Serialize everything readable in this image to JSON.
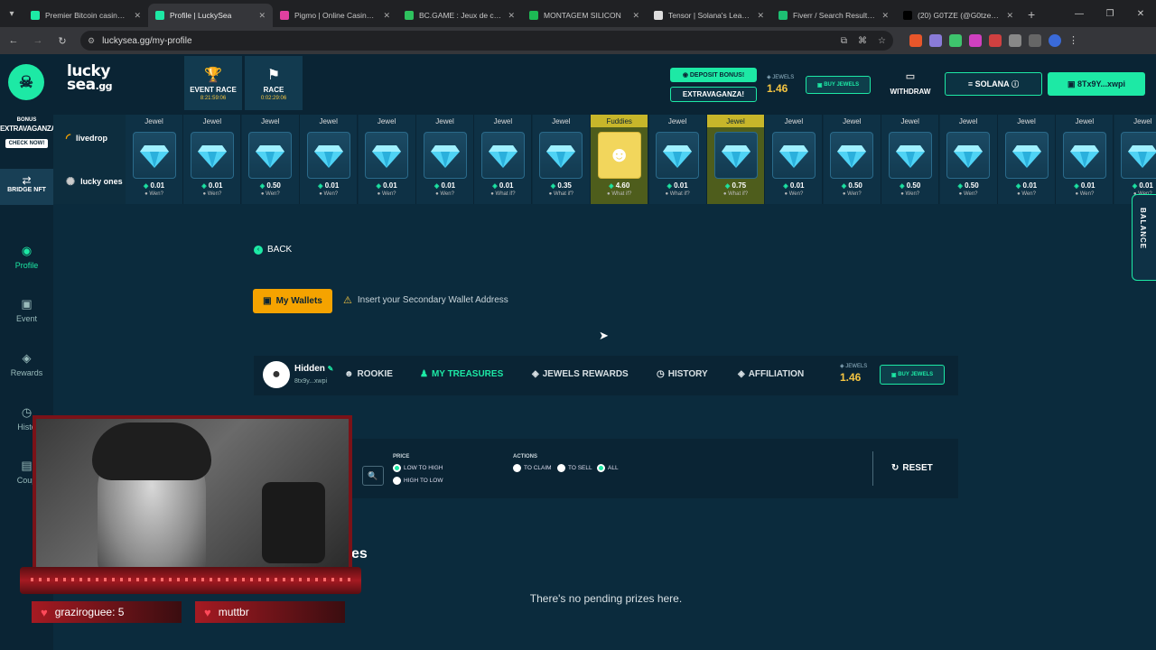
{
  "browser": {
    "tabs": [
      {
        "title": "Premier Bitcoin casino, Et",
        "color": "#1de9a5",
        "active": false
      },
      {
        "title": "Profile | LuckySea",
        "color": "#1de9a5",
        "active": true
      },
      {
        "title": "Pigmo | Online Casino | P",
        "color": "#e040a0",
        "active": false
      },
      {
        "title": "BC.GAME : Jeux de casino",
        "color": "#2ec25e",
        "active": false
      },
      {
        "title": "MONTAGEM SILICON",
        "color": "#1db954",
        "active": false
      },
      {
        "title": "Tensor | Solana's Leading",
        "color": "#dddddd",
        "active": false
      },
      {
        "title": "Fiverr / Search Results for",
        "color": "#1dbf73",
        "active": false
      },
      {
        "title": "(20) G0TZE (@G0tzeWeb",
        "color": "#000000",
        "active": false
      }
    ],
    "url": "luckysea.gg/my-profile"
  },
  "header": {
    "logo_line1": "lucky",
    "logo_line2": "sea",
    "logo_suffix": ".gg",
    "event_race": {
      "label": "EVENT RACE",
      "time": "8:21:59:06"
    },
    "race": {
      "label": "RACE",
      "time": "0:02:29:06"
    },
    "deposit_bonus": "DEPOSIT BONUS!",
    "extravaganza": "EXTRAVAGANZA!",
    "jewels_label": "JEWELS",
    "jewels_value": "1.46",
    "buy_jewels": "BUY JEWELS",
    "withdraw": "WITHDRAW",
    "network": "SOLANA",
    "wallet": "8Tx9Y...xwpi"
  },
  "sidebar": {
    "bonus_label": "BONUS",
    "bonus_title": "EXTRAVAGANZA",
    "bonus_cta": "CHECK NOW!",
    "bridge": "BRIDGE NFT",
    "items": [
      {
        "label": "Profile",
        "icon": "profile-icon",
        "active": true
      },
      {
        "label": "Event",
        "icon": "event-icon",
        "active": false
      },
      {
        "label": "Rewards",
        "icon": "rewards-icon",
        "active": false
      },
      {
        "label": "Histo",
        "icon": "history-icon",
        "active": false
      },
      {
        "label": "Coup",
        "icon": "coupon-icon",
        "active": false
      }
    ]
  },
  "livedrop": {
    "livedrop_label": "livedrop",
    "lucky_ones_label": "lucky ones",
    "items": [
      {
        "name": "Jewel",
        "value": "0.01",
        "status": "Wen?",
        "hl": false
      },
      {
        "name": "Jewel",
        "value": "0.01",
        "status": "Wen?",
        "hl": false
      },
      {
        "name": "Jewel",
        "value": "0.50",
        "status": "Wen?",
        "hl": false
      },
      {
        "name": "Jewel",
        "value": "0.01",
        "status": "Wen?",
        "hl": false
      },
      {
        "name": "Jewel",
        "value": "0.01",
        "status": "Wen?",
        "hl": false
      },
      {
        "name": "Jewel",
        "value": "0.01",
        "status": "Wen?",
        "hl": false
      },
      {
        "name": "Jewel",
        "value": "0.01",
        "status": "What if?",
        "hl": false
      },
      {
        "name": "Jewel",
        "value": "0.35",
        "status": "What if?",
        "hl": false
      },
      {
        "name": "Fuddies",
        "value": "4.60",
        "status": "What if?",
        "hl": true,
        "nft": true
      },
      {
        "name": "Jewel",
        "value": "0.01",
        "status": "What if?",
        "hl": false
      },
      {
        "name": "Jewel",
        "value": "0.75",
        "status": "What if?",
        "hl": true
      },
      {
        "name": "Jewel",
        "value": "0.01",
        "status": "Wen?",
        "hl": false
      },
      {
        "name": "Jewel",
        "value": "0.50",
        "status": "Wen?",
        "hl": false
      },
      {
        "name": "Jewel",
        "value": "0.50",
        "status": "Wen?",
        "hl": false
      },
      {
        "name": "Jewel",
        "value": "0.50",
        "status": "Wen?",
        "hl": false
      },
      {
        "name": "Jewel",
        "value": "0.01",
        "status": "Wen?",
        "hl": false
      },
      {
        "name": "Jewel",
        "value": "0.01",
        "status": "Wen?",
        "hl": false
      },
      {
        "name": "Jewel",
        "value": "0.01",
        "status": "Wen?",
        "hl": false
      }
    ]
  },
  "balance_tab": "BALANCE",
  "main": {
    "back": "BACK",
    "my_wallets": "My Wallets",
    "wallet_warning": "Insert your Secondary Wallet Address",
    "profile": {
      "username": "Hidden",
      "address": "8tx9y...xwpi",
      "rank": "ROOKIE",
      "tabs": [
        "MY TREASURES",
        "JEWELS REWARDS",
        "HISTORY",
        "AFFILIATION"
      ],
      "jewels_label": "JEWELS",
      "jewels_value": "1.46",
      "buy_jewels": "BUY JEWELS"
    },
    "filters": {
      "price_label": "PRICE",
      "price_options": [
        "LOW TO HIGH",
        "HIGH TO LOW"
      ],
      "actions_label": "ACTIONS",
      "action_options": [
        "TO CLAIM",
        "TO SELL",
        "ALL"
      ],
      "reset": "RESET"
    },
    "heading_fragment": "es",
    "empty_message": "There's no pending prizes here."
  },
  "stream": {
    "chat_users": [
      "graziroguee: 5",
      "muttbr"
    ]
  }
}
